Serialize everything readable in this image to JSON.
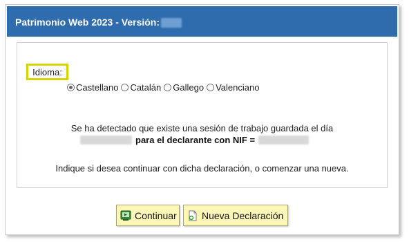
{
  "window": {
    "title": "Patrimonio Web 2023 - Versión:"
  },
  "language": {
    "label": "Idioma:",
    "options": [
      "Castellano",
      "Catalán",
      "Gallego",
      "Valenciano"
    ],
    "selected": "Castellano"
  },
  "message": {
    "line1": "Se ha detectado que existe una sesión de trabajo guardada el día",
    "line2_bold": "para el declarante con NIF =",
    "line3": "Indique si desea continuar con dicha declaración, o comenzar una nueva."
  },
  "buttons": {
    "continue_label": "Continuar",
    "new_label": "Nueva Declaración"
  },
  "icons": {
    "continue": "continue-icon",
    "new": "new-document-icon"
  },
  "colors": {
    "titlebar": "#2f6cad",
    "highlight": "#d6d400",
    "button_bg": "#fcf7b6"
  }
}
